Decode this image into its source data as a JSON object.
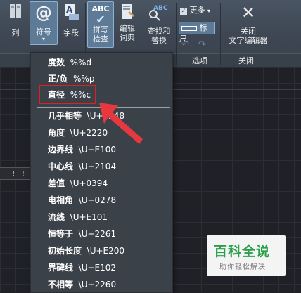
{
  "ribbon": {
    "col_label": "列",
    "symbol_label": "符号",
    "field_label": "字段",
    "spellcheck_label_1": "拼写",
    "spellcheck_label_2": "检查",
    "spellcheck_icon_text": "ABC",
    "dictionary_label_1": "编辑",
    "dictionary_label_2": "词典",
    "find_label_1": "查找和",
    "find_label_2": "替换",
    "find_icon_text": "ABC",
    "more_label": "更多",
    "ruler_label": "标尺",
    "close_label_1": "关闭",
    "close_label_2": "文字编辑器",
    "group_options": "选项",
    "group_close": "关闭"
  },
  "menu": {
    "items": [
      {
        "label": "度数",
        "code": "%%d"
      },
      {
        "label": "正/负",
        "code": "%%p"
      },
      {
        "label": "直径",
        "code": "%%c"
      },
      {
        "label": "几乎相等",
        "code": "\\U+2248"
      },
      {
        "label": "角度",
        "code": "\\U+2220"
      },
      {
        "label": "边界线",
        "code": "\\U+E100"
      },
      {
        "label": "中心线",
        "code": "\\U+2104"
      },
      {
        "label": "差值",
        "code": "\\U+0394"
      },
      {
        "label": "电相角",
        "code": "\\U+0278"
      },
      {
        "label": "流线",
        "code": "\\U+E101"
      },
      {
        "label": "恒等于",
        "code": "\\U+2261"
      },
      {
        "label": "初始长度",
        "code": "\\U+E200"
      },
      {
        "label": "界碑线",
        "code": "\\U+E102"
      },
      {
        "label": "不相等",
        "code": "\\U+2260"
      }
    ]
  },
  "watermark": {
    "title": "百科全说",
    "subtitle": "助你轻松解决"
  },
  "colors": {
    "highlight": "#e02020",
    "arrow": "#e8383f",
    "watermark_green": "#2aa04a"
  }
}
